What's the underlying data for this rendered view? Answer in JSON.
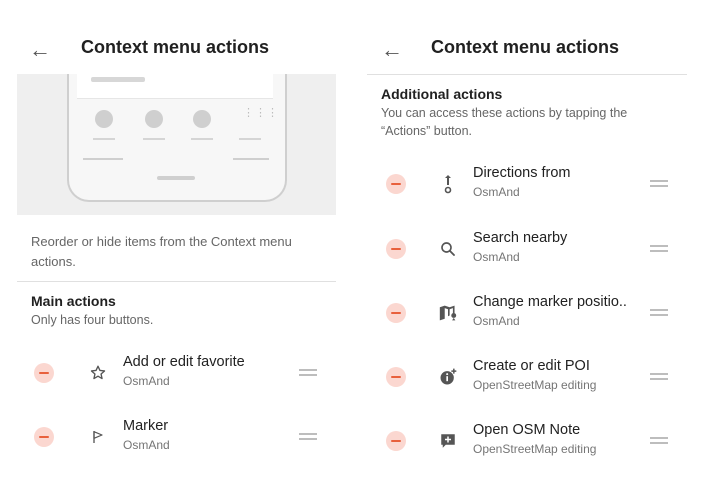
{
  "left": {
    "title": "Context menu actions",
    "description": "Reorder or hide items from the Context menu actions.",
    "section": {
      "title": "Main actions",
      "subtitle": "Only has four buttons."
    },
    "items": [
      {
        "title": "Add or edit favorite",
        "subtitle": "OsmAnd",
        "icon": "star-icon"
      },
      {
        "title": "Marker",
        "subtitle": "OsmAnd",
        "icon": "flag-icon"
      }
    ]
  },
  "right": {
    "title": "Context menu actions",
    "section": {
      "title": "Additional actions",
      "subtitle": "You can access these actions by tapping the “Actions” button."
    },
    "items": [
      {
        "title": "Directions from",
        "subtitle": "OsmAnd",
        "icon": "directions-from-icon"
      },
      {
        "title": "Search nearby",
        "subtitle": "OsmAnd",
        "icon": "search-icon"
      },
      {
        "title": "Change marker positio..",
        "subtitle": "OsmAnd",
        "icon": "map-marker-move-icon"
      },
      {
        "title": "Create or edit POI",
        "subtitle": "OpenStreetMap editing",
        "icon": "poi-edit-icon"
      },
      {
        "title": "Open OSM Note",
        "subtitle": "OpenStreetMap editing",
        "icon": "osm-note-add-icon"
      }
    ]
  },
  "colors": {
    "remove_bg": "#fbd7d0",
    "remove_fg": "#e8603c",
    "accent": "#f19a3e"
  }
}
